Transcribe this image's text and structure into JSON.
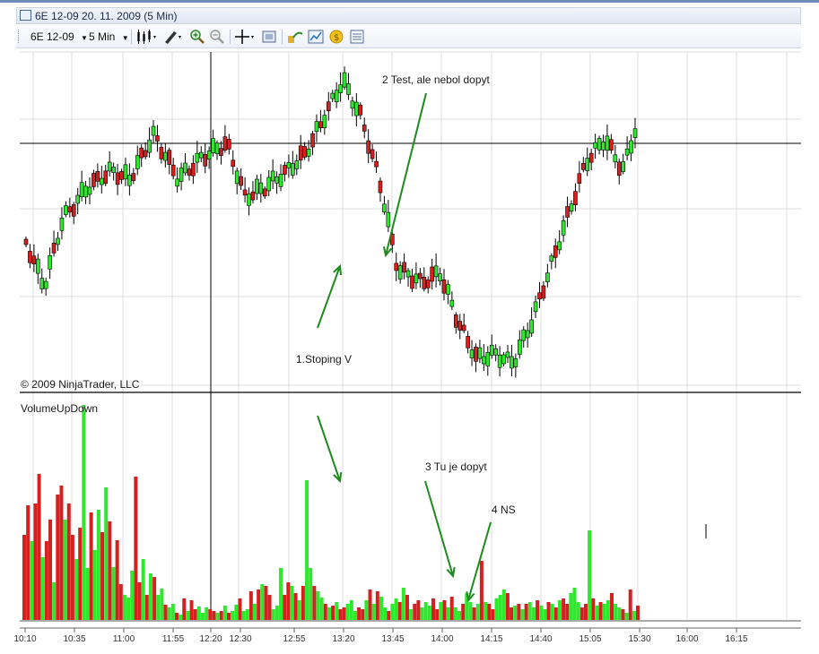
{
  "window": {
    "title": "6E 12-09  20. 11. 2009 (5 Min)"
  },
  "toolbar": {
    "instrument": "6E 12-09",
    "interval": "5 Min",
    "icons": [
      "bar-type-icon",
      "drawing-pen-icon",
      "zoom-in-icon",
      "zoom-out-icon",
      "crosshair-icon",
      "snapshot-icon",
      "data-box-icon",
      "indicators-icon",
      "strategy-icon",
      "properties-icon"
    ]
  },
  "panels": {
    "copyright": "© 2009 NinjaTrader, LLC",
    "volume_label": "VolumeUpDown"
  },
  "annotations": {
    "a1": "1.Stoping V",
    "a2": "2 Test, ale nebol dopyt",
    "a3": "3 Tu je dopyt",
    "a4": "4 NS"
  },
  "colors": {
    "up": "#2ee82e",
    "down": "#d62020",
    "arrow": "#1e8a1e",
    "grid": "#dcdcdc"
  },
  "chart_data": [
    {
      "type": "candlestick",
      "series_name": "6E 12-09",
      "x_tick_labels": [
        "10:10",
        "10:35",
        "11:00",
        "11:55",
        "12:20",
        "12:30",
        "12:55",
        "13:20",
        "13:45",
        "14:00",
        "14:15",
        "14:40",
        "15:05",
        "15:30",
        "16:00",
        "16:15"
      ],
      "ohlc_up_down": [
        0,
        0,
        0,
        1,
        1,
        1,
        1,
        0,
        1,
        1,
        1,
        0,
        0,
        1,
        1,
        1,
        1,
        0,
        0,
        1,
        0,
        1,
        1,
        0,
        0,
        1,
        1,
        0,
        1,
        0,
        0,
        1,
        1,
        0,
        0,
        1,
        0,
        0,
        1,
        1,
        1,
        0,
        0,
        1,
        1,
        0,
        1,
        1,
        1,
        0,
        0,
        0,
        0,
        1,
        0,
        0,
        1,
        0,
        1,
        1,
        0,
        1,
        1,
        1,
        1,
        0,
        1,
        1,
        1,
        0,
        0,
        1,
        0,
        1,
        0,
        1,
        0,
        1,
        1,
        1,
        1,
        1,
        1,
        1,
        0,
        0,
        0,
        0,
        0,
        0,
        1,
        1,
        0,
        0,
        1,
        0,
        1,
        0,
        1,
        0,
        0,
        0,
        0,
        1,
        1,
        0,
        1,
        1,
        0,
        0,
        0,
        0,
        1,
        0,
        1,
        1,
        1,
        1,
        1,
        1,
        1,
        1,
        1,
        1,
        1,
        1,
        1,
        1,
        1,
        0,
        0,
        1,
        1,
        0,
        1,
        1,
        0,
        1,
        0,
        0,
        0,
        1,
        0,
        1,
        1,
        1,
        1,
        0,
        1,
        0,
        1,
        1,
        1,
        1
      ]
    },
    {
      "type": "bar",
      "series_name": "VolumeUpDown"
    }
  ]
}
